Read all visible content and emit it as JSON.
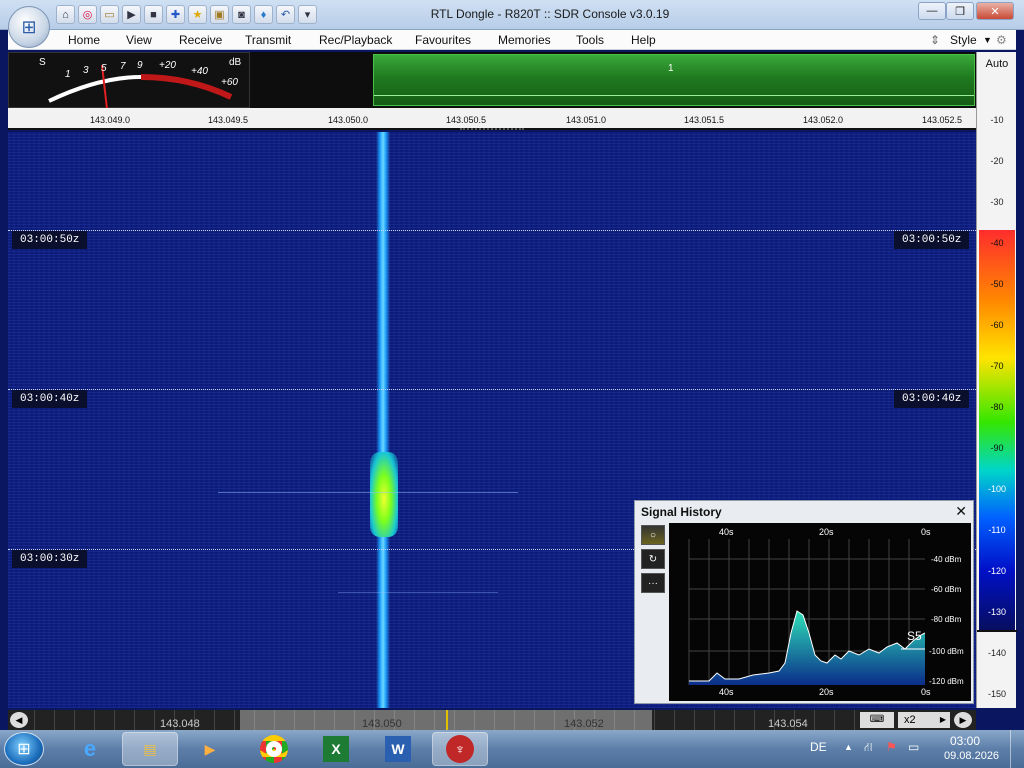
{
  "window": {
    "title": "RTL Dongle - R820T :: SDR Console v3.0.19",
    "minimize_icon": "minimize-icon",
    "maximize_icon": "maximize-icon",
    "close_icon": "close-icon"
  },
  "quick_access": [
    "home-icon",
    "lifebuoy-icon",
    "folder-icon",
    "play-icon",
    "stop-icon",
    "plus-icon",
    "star-icon",
    "lock-icon",
    "camera-icon",
    "drop-icon",
    "undo-icon",
    "dropdown-icon"
  ],
  "menu": {
    "items": [
      "Home",
      "View",
      "Receive",
      "Transmit",
      "Rec/Playback",
      "Favourites",
      "Memories",
      "Tools",
      "Help"
    ],
    "style_label": "Style"
  },
  "smeter": {
    "s_label": "S",
    "db_label": "dB",
    "scale": [
      "1",
      "3",
      "5",
      "7",
      "9",
      "+20",
      "+40",
      "+60"
    ],
    "reading": "S5"
  },
  "top_scope": {
    "channel_marker": "1"
  },
  "ruler": {
    "labels": [
      "143.049.0",
      "143.049.5",
      "143.050.0",
      "143.050.5",
      "143.051.0",
      "143.051.5",
      "143.052.0",
      "143.052.5"
    ]
  },
  "waterfall": {
    "time_labels": [
      "03:00:50z",
      "03:00:40z",
      "03:00:30z"
    ]
  },
  "dbscale": {
    "auto_label": "Auto",
    "ticks": [
      "-10",
      "-20",
      "-30",
      "-40",
      "-50",
      "-60",
      "-70",
      "-80",
      "-90",
      "-100",
      "-110",
      "-120",
      "-130",
      "-140",
      "-150"
    ]
  },
  "tuning_bar": {
    "labels": [
      "143.048",
      "143.050",
      "143.052",
      "143.054"
    ],
    "zoom": "x2"
  },
  "signal_history": {
    "title": "Signal History",
    "close_label": "✕",
    "x_top": [
      "40s",
      "20s",
      "0s"
    ],
    "x_bottom": [
      "40s",
      "20s",
      "0s"
    ],
    "y_labels": [
      "-40 dBm",
      "-60 dBm",
      "-80 dBm",
      "-100 dBm",
      "-120 dBm"
    ],
    "s_reading": "S5",
    "tool_buttons": [
      "record-icon",
      "refresh-icon",
      "more-icon"
    ]
  },
  "taskbar": {
    "apps": [
      "ie-icon",
      "explorer-icon",
      "media-player-icon",
      "chrome-icon",
      "excel-icon",
      "word-icon",
      "sdr-console-icon"
    ],
    "language": "DE",
    "time": "03:00",
    "date": "09.08.2026"
  },
  "colors": {
    "waterfall_bg": "#0c1a78",
    "trace": "#1ea0ff",
    "peak": "#f0ff30",
    "scope_green": "#1f7a1f"
  }
}
